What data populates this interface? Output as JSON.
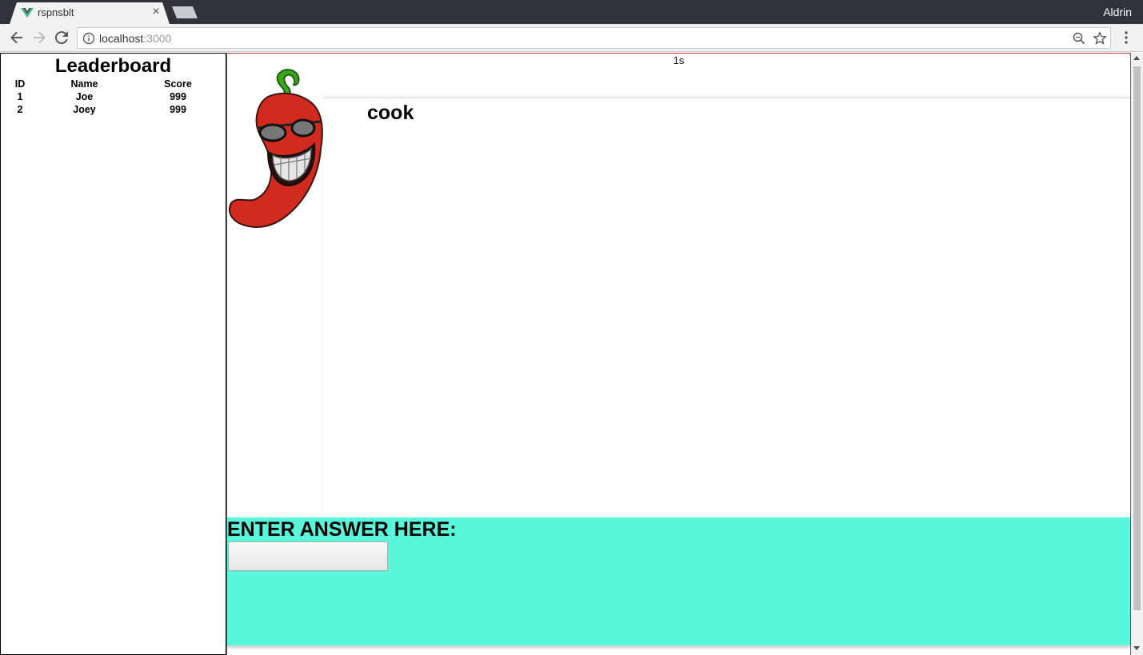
{
  "browser": {
    "tab_title": "rspnsblt",
    "profile_name": "Aldrin",
    "url_host": "localhost",
    "url_port": ":3000"
  },
  "leaderboard": {
    "title": "Leaderboard",
    "columns": [
      "ID",
      "Name",
      "Score"
    ],
    "rows": [
      {
        "id": "1",
        "name": "Joe",
        "score": "999"
      },
      {
        "id": "2",
        "name": "Joey",
        "score": "999"
      }
    ]
  },
  "game": {
    "timer": "1s",
    "word": "cook",
    "answer_label": "ENTER ANSWER HERE:",
    "answer_value": ""
  },
  "colors": {
    "answer_panel": "#59f8dc",
    "game_border": "#c0392b",
    "tab_bar": "#30323c"
  },
  "icons": [
    "vue-favicon-icon",
    "close-icon",
    "back-arrow-icon",
    "forward-arrow-icon",
    "reload-icon",
    "info-icon",
    "zoom-icon",
    "star-icon",
    "menu-icon",
    "chili-pepper-mascot"
  ]
}
